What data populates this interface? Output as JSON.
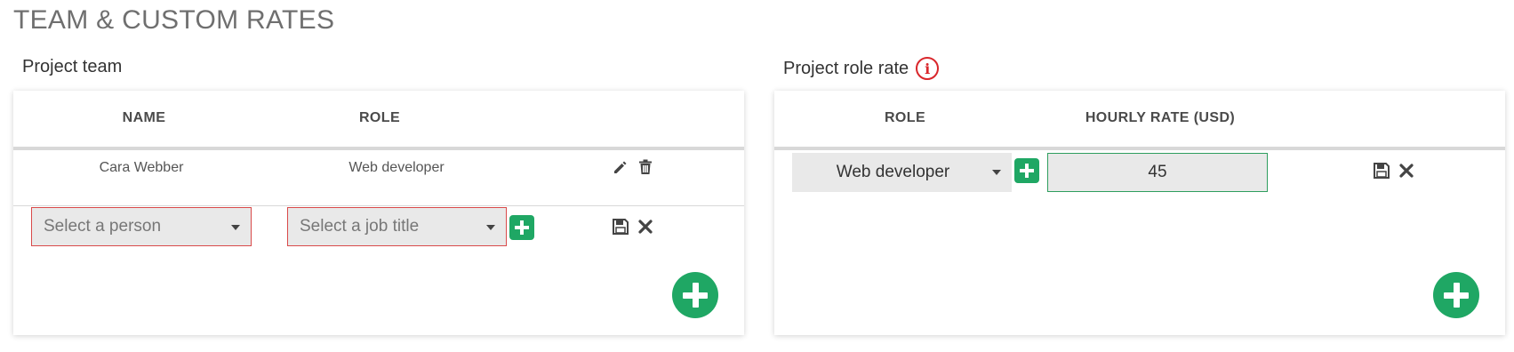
{
  "page": {
    "title": "TEAM & CUSTOM RATES"
  },
  "team": {
    "title": "Project team",
    "columns": {
      "name": "NAME",
      "role": "ROLE"
    },
    "rows": [
      {
        "name": "Cara Webber",
        "role": "Web developer"
      }
    ],
    "new_row": {
      "person_placeholder": "Select a person",
      "job_placeholder": "Select a job title"
    }
  },
  "rate": {
    "title": "Project role rate",
    "info_symbol": "i",
    "columns": {
      "role": "ROLE",
      "hourly_rate": "HOURLY RATE (USD)"
    },
    "row": {
      "role": "Web developer",
      "hourly_rate": "45"
    }
  },
  "icons": {
    "edit": "pencil-icon",
    "delete": "trash-icon",
    "save": "floppy-disk-icon",
    "cancel": "close-icon",
    "add": "plus-icon",
    "info": "info-icon",
    "dropdown": "caret-down-icon"
  },
  "colors": {
    "accent_green": "#1fa764",
    "error_red": "#d9262b",
    "input_bg": "#e9e9e9"
  }
}
